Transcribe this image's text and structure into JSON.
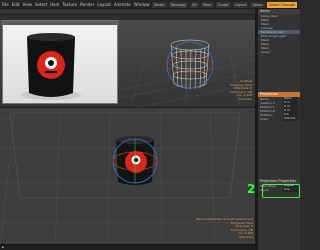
{
  "menu": {
    "items": [
      "File",
      "Edit",
      "View",
      "Select",
      "Item",
      "Texture",
      "Render",
      "Layout",
      "Animate",
      "Window",
      "Help"
    ]
  },
  "layout_tabs": {
    "items": [
      "Model",
      "Topology",
      "UV",
      "Paint",
      "Sculpt",
      "Layout",
      "Setup",
      "Select Through"
    ],
    "active_index": 7
  },
  "viewport_top": {
    "info": [
      "Untitled",
      "Polygons: Face",
      "Channels: 0",
      "Deformers: ON",
      "GL: 4,396",
      "Unknown"
    ]
  },
  "viewport_bottom": {
    "info": [
      "Textured/Shaded: Smooth (Advanced)",
      "Polygons: Face",
      "Channels: 0",
      "Deformers: ON",
      "GL: 4,396",
      "Unknown"
    ]
  },
  "panel": {
    "header": "Items",
    "items": [
      "Scene Item",
      "Mesh",
      "Mesh",
      "Camera",
      "Texture Locator",
      "Directional Light",
      "Mesh",
      "Mesh",
      "Mesh",
      "Group"
    ],
    "properties_header": "Properties",
    "props": [
      {
        "label": "Name",
        "value": "Mesh"
      },
      {
        "label": "Position X",
        "value": "0 m"
      },
      {
        "label": "Position Y",
        "value": "0 m"
      },
      {
        "label": "Position Z",
        "value": "0 m"
      },
      {
        "label": "Rotation",
        "value": "0.0"
      },
      {
        "label": "Scale",
        "value": "100.0%"
      }
    ],
    "section": "Projection Properties",
    "highlight_props": [
      {
        "label": "Pixel Wrap",
        "value": "Repeat"
      },
      {
        "label": "Alpha",
        "value": "Use"
      }
    ]
  },
  "callout": {
    "number": "2"
  },
  "colors": {
    "accent": "#f2a33a",
    "callout": "#33ff33",
    "selection": "#4e5b6e"
  }
}
